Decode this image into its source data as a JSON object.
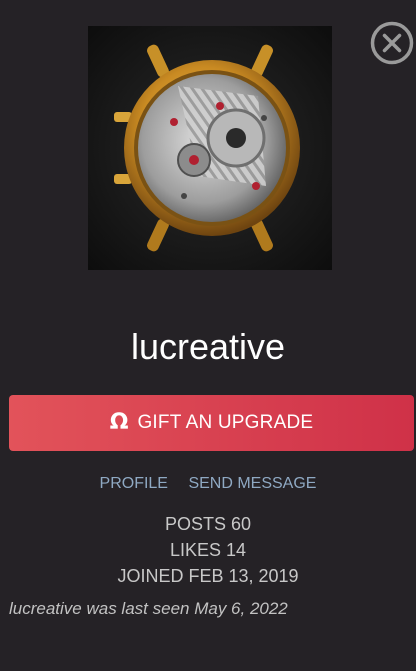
{
  "profile": {
    "username": "lucreative",
    "avatar_icon": "watch-movement-photo"
  },
  "actions": {
    "close_icon": "close-circle-icon",
    "gift_icon": "omega-icon",
    "gift_symbol": "Ω",
    "gift_label": "GIFT AN UPGRADE",
    "gift_color": "#d9404f"
  },
  "links": {
    "profile_label": "PROFILE",
    "message_label": "SEND MESSAGE",
    "link_color": "#8fa9c3"
  },
  "stats": {
    "posts_label": "POSTS",
    "posts_value": "60",
    "likes_label": "LIKES",
    "likes_value": "14",
    "joined_label": "JOINED",
    "joined_value": "FEB 13, 2019"
  },
  "last_seen": "lucreative was last seen May 6, 2022",
  "colors": {
    "background": "#252226",
    "text": "#ffffff",
    "muted": "#c8c8c8"
  }
}
